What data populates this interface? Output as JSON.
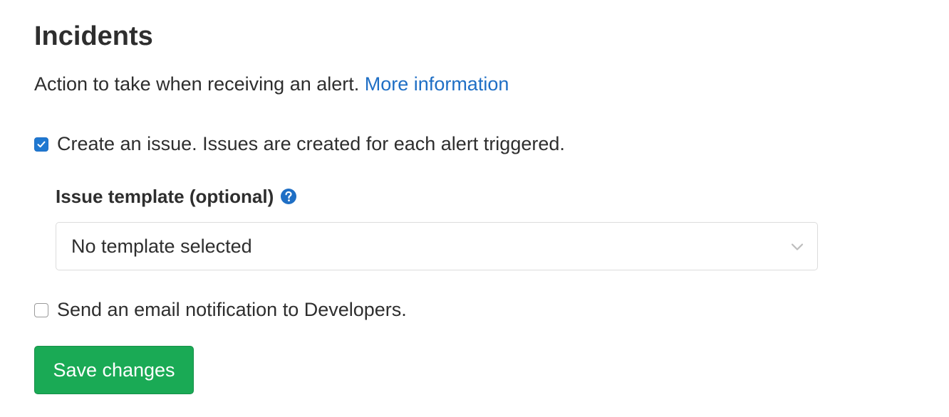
{
  "section": {
    "title": "Incidents",
    "description": "Action to take when receiving an alert.",
    "more_info_link": "More information"
  },
  "create_issue": {
    "checked": true,
    "label": "Create an issue. Issues are created for each alert triggered."
  },
  "issue_template": {
    "label": "Issue template (optional)",
    "help_icon": "question-circle-icon",
    "selected_value": "No template selected",
    "dropdown_icon": "chevron-down-icon"
  },
  "email_notification": {
    "checked": false,
    "label": "Send an email notification to Developers."
  },
  "actions": {
    "save_label": "Save changes"
  },
  "colors": {
    "link": "#1f6fc5",
    "checkbox_checked": "#1f78d1",
    "save_button": "#1aaa55",
    "text": "#2e2e2e"
  }
}
